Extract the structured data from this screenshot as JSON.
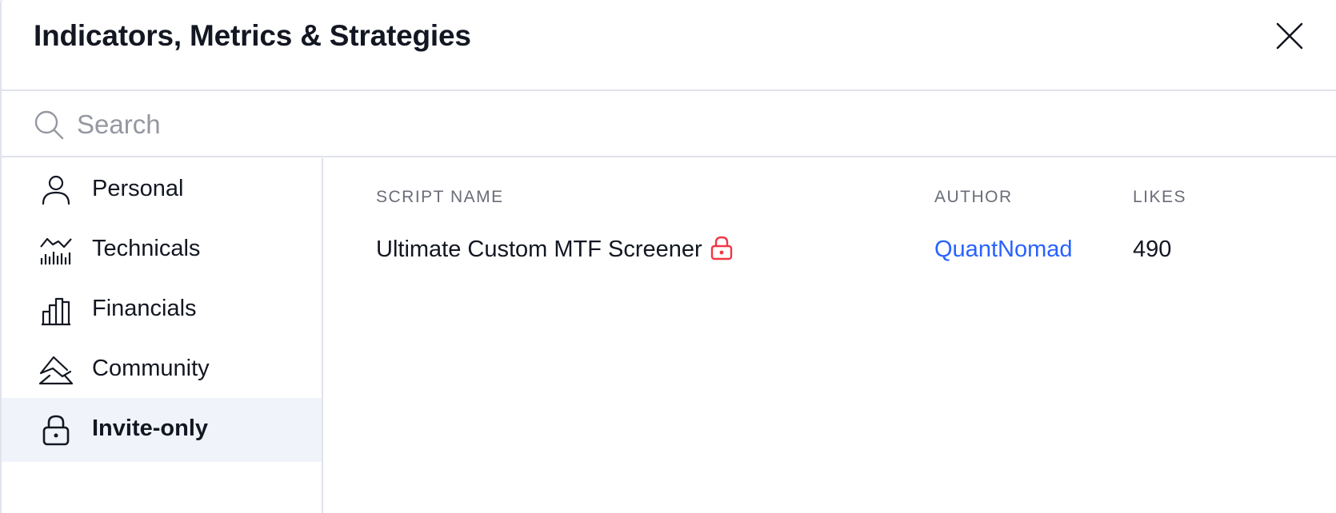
{
  "dialog": {
    "title": "Indicators, Metrics & Strategies",
    "close_icon": "close-icon"
  },
  "search": {
    "placeholder": "Search",
    "value": "",
    "icon": "search-icon"
  },
  "sidebar": {
    "items": [
      {
        "label": "Personal",
        "icon": "person-icon",
        "active": false
      },
      {
        "label": "Technicals",
        "icon": "technicals-chart-icon",
        "active": false
      },
      {
        "label": "Financials",
        "icon": "bar-chart-icon",
        "active": false
      },
      {
        "label": "Community",
        "icon": "community-mountain-icon",
        "active": false
      },
      {
        "label": "Invite-only",
        "icon": "lock-icon",
        "active": true
      }
    ]
  },
  "table": {
    "columns": {
      "name": "SCRIPT NAME",
      "author": "AUTHOR",
      "likes": "LIKES"
    },
    "rows": [
      {
        "name": "Ultimate Custom MTF Screener",
        "badge_icon": "lock-icon",
        "author": "QuantNomad",
        "likes": "490"
      }
    ]
  },
  "colors": {
    "accent": "#2962ff",
    "lock_badge": "#f23645",
    "active_item_bg": "#f0f3fa",
    "text": "#131722",
    "muted": "#6a6d78",
    "border": "#e0e3eb"
  }
}
